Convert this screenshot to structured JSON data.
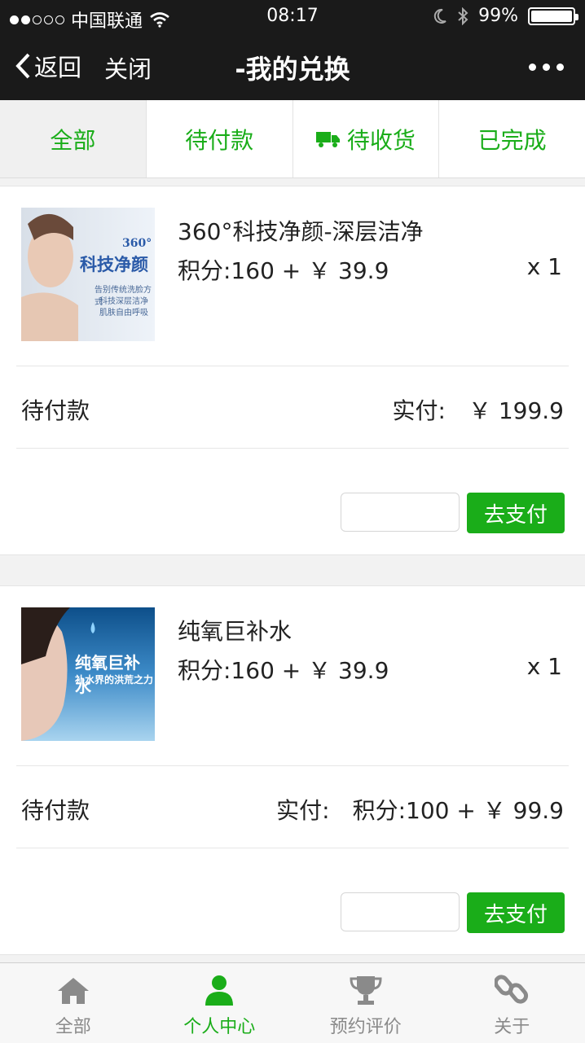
{
  "status_bar": {
    "carrier": "中国联通",
    "time": "08:17",
    "battery": "99%",
    "battery_level": 0.99,
    "signal_strength": 2
  },
  "nav": {
    "back_label": "返回",
    "close_label": "关闭",
    "title": "-我的兑换"
  },
  "tabs": [
    {
      "label": "全部",
      "active": true
    },
    {
      "label": "待付款"
    },
    {
      "label": "待收货",
      "icon": "truck-icon"
    },
    {
      "label": "已完成"
    }
  ],
  "orders": [
    {
      "product_name": "360°科技净颜-深层洁净",
      "price": "积分:160 + ￥ 39.9",
      "quantity": "x 1",
      "status": "待付款",
      "paid_label": "实付:",
      "paid_value": "￥ 199.9",
      "pay_button": "去支付",
      "thumbnail": {
        "badge": "360°",
        "headline": "科技净颜",
        "lines": [
          "告别传统洗脸方式",
          "科技深层洁净",
          "肌肤自由呼吸"
        ]
      }
    },
    {
      "product_name": "纯氧巨补水",
      "price": "积分:160 + ￥ 39.9",
      "quantity": "x 1",
      "status": "待付款",
      "paid_label": "实付:",
      "paid_value": "积分:100 + ￥ 99.9",
      "pay_button": "去支付",
      "thumbnail": {
        "headline": "纯氧巨补水",
        "subline": "补水界的洪荒之力"
      }
    }
  ],
  "tabbar": [
    {
      "label": "全部",
      "icon": "home-icon"
    },
    {
      "label": "个人中心",
      "icon": "user-icon",
      "active": true
    },
    {
      "label": "预约评价",
      "icon": "trophy-icon"
    },
    {
      "label": "关于",
      "icon": "link-icon"
    }
  ],
  "colors": {
    "accent": "#1aad19",
    "nav_bg": "#1a1a1a"
  }
}
